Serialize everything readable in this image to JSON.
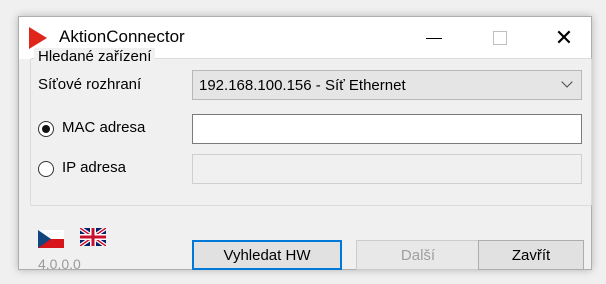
{
  "window": {
    "title": "AktionConnector",
    "minimize_label": "—",
    "close_label": "✕"
  },
  "group": {
    "title": "Hledané zařízení",
    "interface_label": "Síťové rozhraní",
    "interface_value": "192.168.100.156 - Síť Ethernet",
    "mac_label": "MAC adresa",
    "mac_value": "",
    "mac_selected": true,
    "ip_label": "IP adresa",
    "ip_value": "",
    "ip_selected": false
  },
  "languages": [
    "cs",
    "en"
  ],
  "version": "4.0.0.0",
  "buttons": {
    "search": "Vyhledat HW",
    "next": "Další",
    "close": "Zavřít"
  },
  "colors": {
    "accent": "#0078d7",
    "logo_red": "#e0251b"
  }
}
